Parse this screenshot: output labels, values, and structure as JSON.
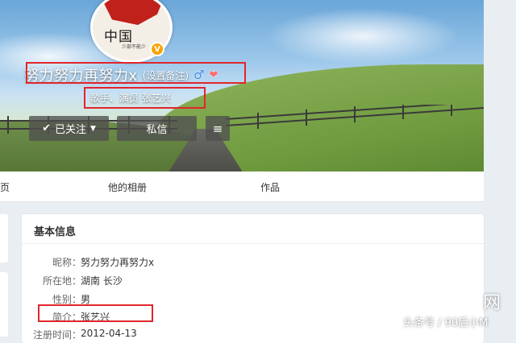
{
  "avatar": {
    "text": "中国",
    "sub_text": "少部不能少"
  },
  "verified_badge": "V",
  "profile": {
    "name": "努力努力再努力x",
    "remark": "(设置备注)",
    "gender_symbol": "♂",
    "extra_badge_symbol": "❤",
    "bio": "歌手、演员 张艺兴"
  },
  "actions": {
    "follow_label": "已关注",
    "follow_check": "✔",
    "follow_caret": "▼",
    "message_label": "私信",
    "menu_symbol": "≡"
  },
  "tabs": [
    {
      "label": "页"
    },
    {
      "label": "他的相册"
    },
    {
      "label": "作品"
    }
  ],
  "info_card": {
    "title": "基本信息",
    "rows": [
      {
        "label": "昵称：",
        "value": "努力努力再努力x"
      },
      {
        "label": "所在地：",
        "value": "湖南 长沙"
      },
      {
        "label": "性别：",
        "value": "男"
      },
      {
        "label": "简介：",
        "value": "张艺兴"
      },
      {
        "label": "注册时间：",
        "value": "2012-04-13"
      }
    ]
  },
  "watermark": {
    "text": "头条号 / 90后小M",
    "icon_text": "网"
  },
  "colors": {
    "highlight": "#e0262b",
    "verified": "#f7a400",
    "button_bg": "#505050"
  }
}
